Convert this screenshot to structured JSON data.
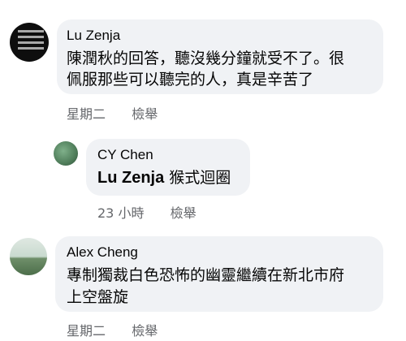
{
  "comments": [
    {
      "author": "Lu Zenja",
      "avatar_icon": "user-avatar-icon",
      "lines": [
        "陳潤秋的回答，聽沒幾分鐘就受不了。很",
        "佩服那些可以聽完的人，真是辛苦了"
      ],
      "time": "星期二",
      "report": "檢舉"
    },
    {
      "author": "CY Chen",
      "avatar_icon": "user-avatar-icon",
      "mention": "Lu Zenja",
      "reply_text": " 猴式迴圈",
      "time": "23 小時",
      "report": "檢舉"
    },
    {
      "author": "Alex Cheng",
      "avatar_icon": "user-avatar-icon",
      "lines": [
        "專制獨裁白色恐怖的幽靈繼續在新北市府",
        "上空盤旋"
      ],
      "time": "星期二",
      "report": "檢舉"
    }
  ],
  "colors": {
    "bubble": "#f0f2f5",
    "meta": "#65676b",
    "text": "#050505"
  }
}
